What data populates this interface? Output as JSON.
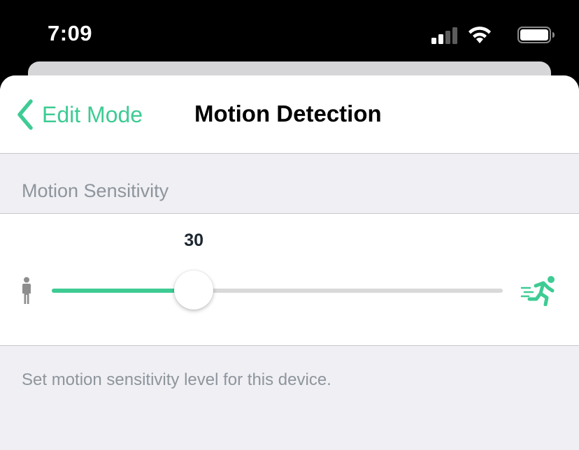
{
  "status_bar": {
    "time": "7:09",
    "icons": [
      "signal-icon",
      "wifi-icon",
      "battery-icon"
    ]
  },
  "nav": {
    "back_label": "Edit Mode",
    "title": "Motion Detection"
  },
  "section": {
    "header": "Motion Sensitivity"
  },
  "slider": {
    "value": "30",
    "fraction": 0.315,
    "min_icon": "walking-person-icon",
    "max_icon": "running-person-icon"
  },
  "footer": {
    "description": "Set motion sensitivity level for this device."
  },
  "colors": {
    "accent": "#3ecb94",
    "secondary_text": "#8e959c",
    "background": "#efeff4",
    "walk_icon": "#8e8e8e"
  }
}
